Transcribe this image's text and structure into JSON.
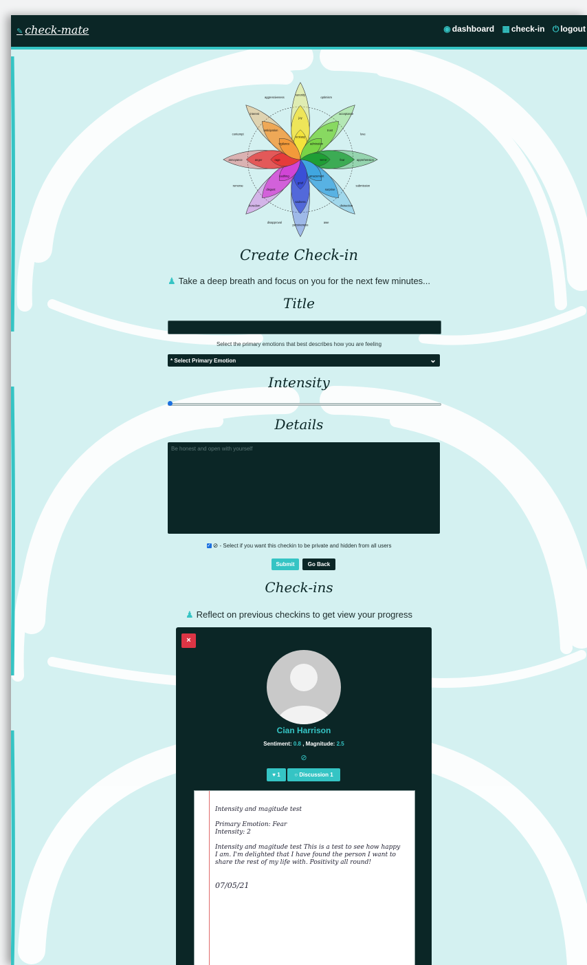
{
  "nav": {
    "brand": "check-mate",
    "links": [
      {
        "icon": "user-circle-icon",
        "label": "dashboard"
      },
      {
        "icon": "calendar-icon",
        "label": "check-in"
      },
      {
        "icon": "power-icon",
        "label": "logout"
      }
    ]
  },
  "emotion_wheel": {
    "outer_labels": [
      "optimism",
      "love",
      "submission",
      "awe",
      "disapproval",
      "remorse",
      "contempt",
      "aggressiveness"
    ],
    "petals": [
      {
        "name": "joy",
        "outer": "serenity",
        "mid": "joy",
        "inner": "ecstasy",
        "color": "#f3e33b"
      },
      {
        "name": "trust",
        "outer": "acceptance",
        "mid": "trust",
        "inner": "admiration",
        "color": "#79d446"
      },
      {
        "name": "fear",
        "outer": "apprehension",
        "mid": "fear",
        "inner": "terror",
        "color": "#1f9e35"
      },
      {
        "name": "surprise",
        "outer": "distraction",
        "mid": "surprise",
        "inner": "amazement",
        "color": "#40a6e0"
      },
      {
        "name": "sadness",
        "outer": "pensiveness",
        "mid": "sadness",
        "inner": "grief",
        "color": "#3a4fd6"
      },
      {
        "name": "disgust",
        "outer": "boredom",
        "mid": "disgust",
        "inner": "loathing",
        "color": "#d145d6"
      },
      {
        "name": "anger",
        "outer": "annoyance",
        "mid": "anger",
        "inner": "rage",
        "color": "#e53b3b"
      },
      {
        "name": "anticipation",
        "outer": "interest",
        "mid": "anticipation",
        "inner": "vigilance",
        "color": "#f39a3a"
      }
    ]
  },
  "form": {
    "heading": "Create Check-in",
    "subtitle": "Take a deep breath and focus on you for the next few minutes...",
    "title_label": "Title",
    "title_value": "",
    "emotion_help": "Select the primary emotions that best describes how you are feeling",
    "emotion_select": "* Select Primary Emotion",
    "intensity_label": "Intensity",
    "intensity_value": 0,
    "details_label": "Details",
    "details_placeholder": "Be honest and open with yourself",
    "private_text": "- Select if you want this checkin to be private and hidden from all users",
    "private_checked": true,
    "submit_label": "Submit",
    "back_label": "Go Back"
  },
  "checkins": {
    "heading": "Check-ins",
    "subtitle": "Reflect on previous checkins to get view your progress",
    "cards": [
      {
        "close_label": "×",
        "name": "Cian Harrison",
        "sentiment_label": "Sentiment:",
        "sentiment": "0.8",
        "magnitude_label": ", Magnitude:",
        "magnitude": "2.5",
        "likes": "1",
        "discussion_label": "Discussion 1",
        "note_title": "Intensity and magitude test",
        "primary_emotion": "Primary Emotion: Fear",
        "intensity": "Intensity: 2",
        "body": "Intensity and magitude test This is a test to see how happy I am. I'm delighted that I have found the person I want to share the rest of my life with. Positivity all round!",
        "date": "07/05/21"
      }
    ]
  },
  "colors": {
    "nav_bg": "#0b2626",
    "accent": "#35c4c4",
    "page_bg": "#d4f1f1",
    "danger": "#dc3545"
  }
}
